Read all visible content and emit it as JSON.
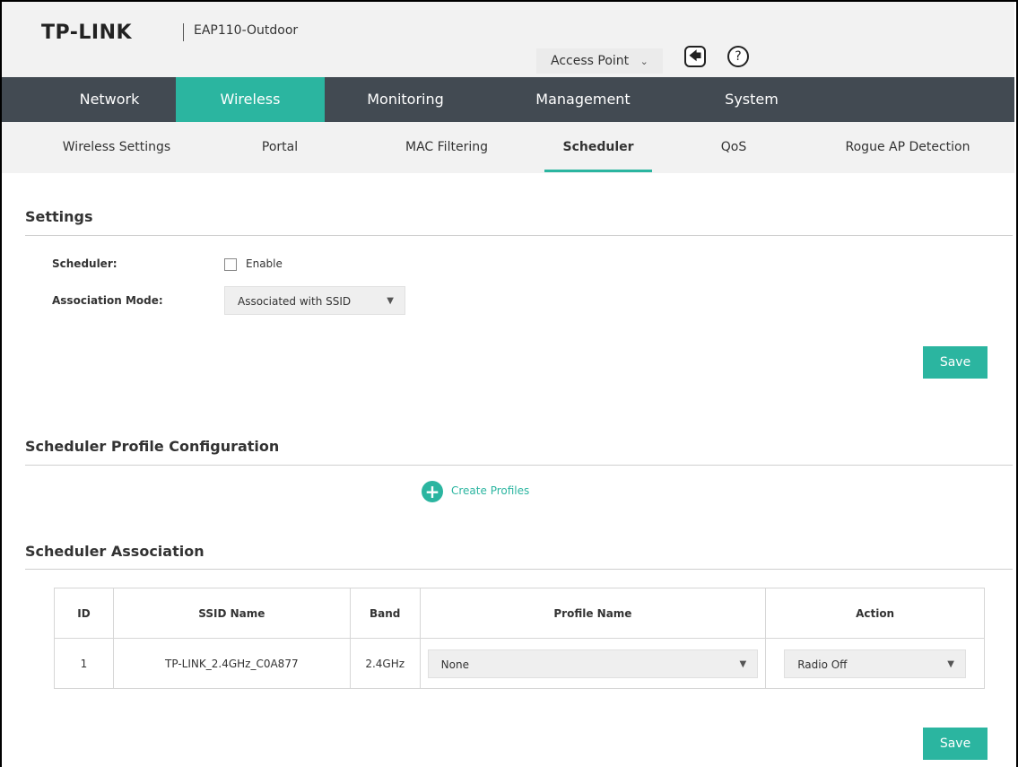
{
  "header": {
    "brand": "TP-LINK",
    "model": "EAP110-Outdoor",
    "mode_select": "Access Point",
    "mode_chevron_icon": "chevron-down-icon",
    "logout_icon": "logout-icon",
    "help_icon": "help-icon",
    "help_glyph": "?"
  },
  "main_nav": [
    "Network",
    "Wireless",
    "Monitoring",
    "Management",
    "System"
  ],
  "main_nav_active": "Wireless",
  "sub_nav": [
    "Wireless Settings",
    "Portal",
    "MAC Filtering",
    "Scheduler",
    "QoS",
    "Rogue AP Detection"
  ],
  "sub_nav_active": "Scheduler",
  "settings": {
    "title": "Settings",
    "scheduler_label": "Scheduler:",
    "enable_label": "Enable",
    "enable_checked": false,
    "association_mode_label": "Association Mode:",
    "association_mode_value": "Associated with SSID",
    "save_label": "Save"
  },
  "profile_config": {
    "title": "Scheduler Profile Configuration",
    "create_label": "Create Profiles",
    "create_icon": "plus-circle-icon"
  },
  "association": {
    "title": "Scheduler Association",
    "columns": [
      "ID",
      "SSID Name",
      "Band",
      "Profile Name",
      "Action"
    ],
    "rows": [
      {
        "id": "1",
        "ssid": "TP-LINK_2.4GHz_C0A877",
        "band": "2.4GHz",
        "profile": "None",
        "action": "Radio Off"
      }
    ],
    "save_label": "Save"
  },
  "colors": {
    "accent": "#2bb5a0",
    "nav_bg": "#424a52",
    "header_bg": "#f2f2f2"
  }
}
